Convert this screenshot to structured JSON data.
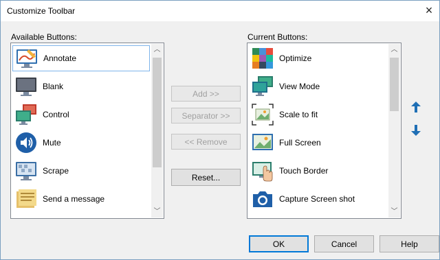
{
  "window": {
    "title": "Customize Toolbar",
    "close_glyph": "×"
  },
  "available": {
    "label": "Available Buttons:",
    "items": [
      {
        "label": "Annotate",
        "icon": "annotate-icon"
      },
      {
        "label": "Blank",
        "icon": "blank-monitor-icon"
      },
      {
        "label": "Control",
        "icon": "control-monitors-icon"
      },
      {
        "label": "Mute",
        "icon": "speaker-icon"
      },
      {
        "label": "Scrape",
        "icon": "scrape-icon"
      },
      {
        "label": "Send a message",
        "icon": "message-icon"
      }
    ],
    "selected_index": 0
  },
  "current": {
    "label": "Current Buttons:",
    "items": [
      {
        "label": "Optimize",
        "icon": "optimize-icon"
      },
      {
        "label": "View Mode",
        "icon": "view-mode-icon"
      },
      {
        "label": "Scale to fit",
        "icon": "scale-to-fit-icon"
      },
      {
        "label": "Full Screen",
        "icon": "full-screen-icon"
      },
      {
        "label": "Touch Border",
        "icon": "touch-border-icon"
      },
      {
        "label": "Capture Screen shot",
        "icon": "camera-icon"
      }
    ]
  },
  "buttons": {
    "add": "Add >>",
    "separator": "Separator >>",
    "remove": "<< Remove",
    "reset": "Reset...",
    "ok": "OK",
    "cancel": "Cancel",
    "help": "Help"
  },
  "colors": {
    "accent": "#0078d7",
    "arrow_blue": "#1f6fb5",
    "selection_border": "#7eb4ea"
  }
}
